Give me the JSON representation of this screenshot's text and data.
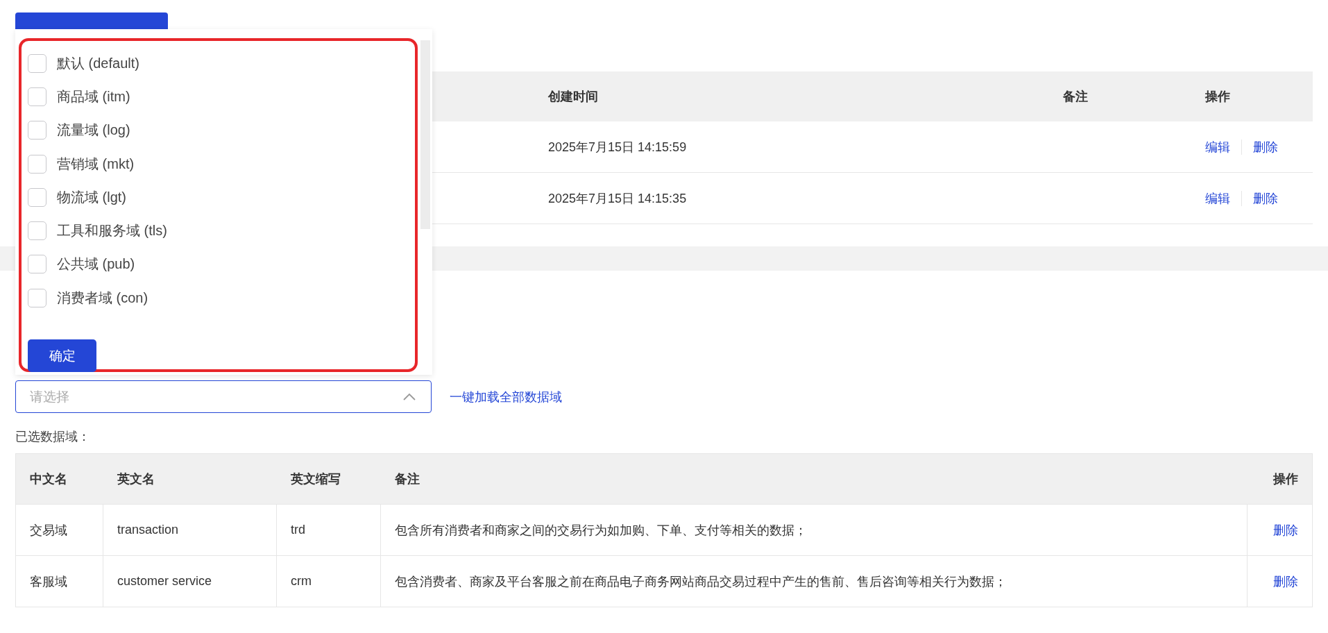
{
  "top_table": {
    "columns": [
      "创建时间",
      "备注",
      "操作"
    ],
    "rows": [
      {
        "created": "2025年7月15日 14:15:59",
        "actions": [
          "编辑",
          "删除"
        ]
      },
      {
        "created": "2025年7月15日 14:15:35",
        "actions": [
          "编辑",
          "删除"
        ]
      }
    ]
  },
  "dropdown": {
    "highlighted": true,
    "options": [
      {
        "label": "默认 (default)",
        "checked": false
      },
      {
        "label": "商品域 (itm)",
        "checked": false
      },
      {
        "label": "流量域 (log)",
        "checked": false
      },
      {
        "label": "营销域 (mkt)",
        "checked": false
      },
      {
        "label": "物流域 (lgt)",
        "checked": false
      },
      {
        "label": "工具和服务域 (tls)",
        "checked": false
      },
      {
        "label": "公共域 (pub)",
        "checked": false
      },
      {
        "label": "消费者域 (con)",
        "checked": false
      }
    ],
    "confirm": "确定"
  },
  "select": {
    "placeholder": "请选择",
    "expanded": true
  },
  "load_all_link": "一键加载全部数据域",
  "selected_label": "已选数据域：",
  "selected_table": {
    "columns": [
      "中文名",
      "英文名",
      "英文缩写",
      "备注",
      "操作"
    ],
    "rows": [
      {
        "cells": [
          "交易域",
          "transaction",
          "trd",
          "包含所有消费者和商家之间的交易行为如加购、下单、支付等相关的数据；"
        ],
        "action": "删除"
      },
      {
        "cells": [
          "客服域",
          "customer service",
          "crm",
          "包含消费者、商家及平台客服之前在商品电子商务网站商品交易过程中产生的售前、售后咨询等相关行为数据；"
        ],
        "action": "删除"
      }
    ]
  }
}
